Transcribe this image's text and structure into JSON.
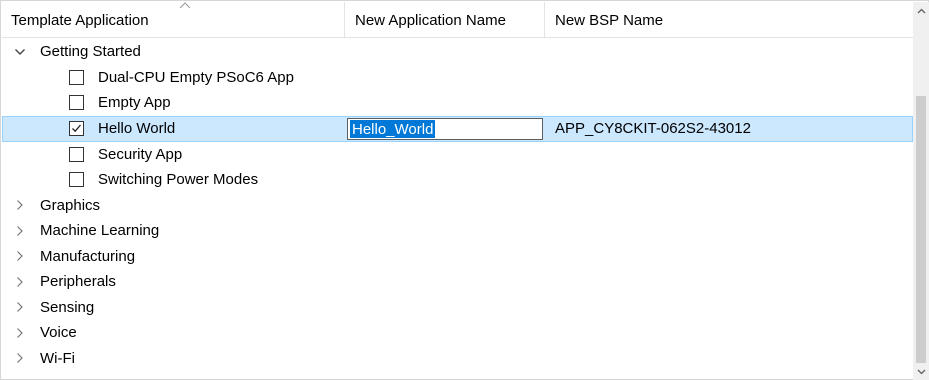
{
  "columns": {
    "template": "Template Application",
    "new_name": "New Application Name",
    "new_bsp": "New BSP Name"
  },
  "groups": [
    {
      "label": "Getting Started",
      "expanded": true
    },
    {
      "label": "Graphics",
      "expanded": false
    },
    {
      "label": "Machine Learning",
      "expanded": false
    },
    {
      "label": "Manufacturing",
      "expanded": false
    },
    {
      "label": "Peripherals",
      "expanded": false
    },
    {
      "label": "Sensing",
      "expanded": false
    },
    {
      "label": "Voice",
      "expanded": false
    },
    {
      "label": "Wi-Fi",
      "expanded": false
    }
  ],
  "apps": [
    {
      "label": "Dual-CPU Empty PSoC6 App",
      "checked": false
    },
    {
      "label": "Empty App",
      "checked": false
    },
    {
      "label": "Hello World",
      "checked": true,
      "new_name": "Hello_World",
      "bsp": "APP_CY8CKIT-062S2-43012"
    },
    {
      "label": "Security App",
      "checked": false
    },
    {
      "label": "Switching Power Modes",
      "checked": false
    }
  ],
  "colors": {
    "selection": "#cce8ff",
    "selection_border": "#99d1ff",
    "text_selection": "#0078d7"
  }
}
